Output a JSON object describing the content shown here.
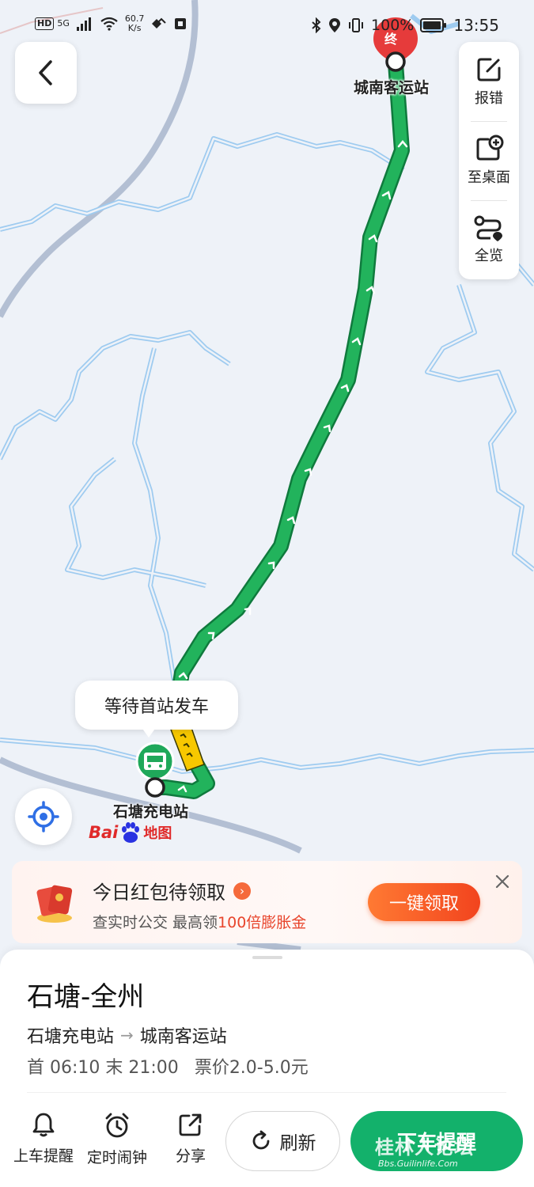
{
  "status_bar": {
    "hd": "HD",
    "network": "5G",
    "speed_value": "60.7",
    "speed_unit": "K/s",
    "battery": "100%",
    "time": "13:55"
  },
  "map": {
    "terminal_badge": "终",
    "terminal_station": "城南客运站",
    "start_station": "石塘充电站",
    "bubble_text": "等待首站发车",
    "route_color": "#1fa85a",
    "bus_color": "#f7c800"
  },
  "tools": {
    "report": "报错",
    "desktop": "至桌面",
    "overview": "全览"
  },
  "logo": {
    "bai": "Bai",
    "ditu": "地图"
  },
  "promo": {
    "title": "今日红包待领取",
    "sub_prefix": "查实时公交 最高领",
    "sub_highlight": "100倍膨胀金",
    "claim_button": "一键领取"
  },
  "route": {
    "name": "石塘-全州",
    "from": "石塘充电站",
    "to": "城南客运站",
    "first_bus": "首 06:10",
    "last_bus": "末 21:00",
    "fare": "票价2.0-5.0元"
  },
  "actions": {
    "board_reminder": "上车提醒",
    "alarm": "定时闹钟",
    "share": "分享",
    "refresh": "刷新",
    "alight_reminder": "下车提醒"
  },
  "watermark": {
    "main": "桂林人论坛",
    "url": "Bbs.Guilinlife.Com"
  }
}
